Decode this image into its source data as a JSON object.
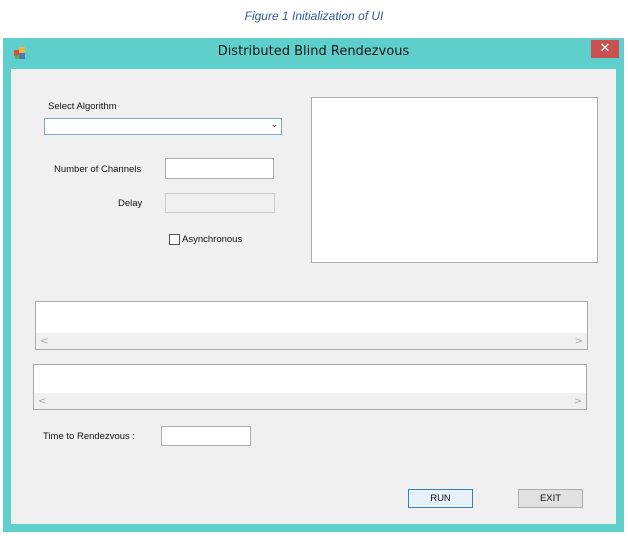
{
  "caption": "Figure 1 Initialization of UI",
  "window": {
    "title": "Distributed Blind Rendezvous",
    "close_glyph": "✕"
  },
  "form": {
    "select_algorithm_label": "Select Algorithm",
    "select_algorithm_value": "",
    "dropdown_arrow": "⌄",
    "channels_label": "Number of Channels",
    "channels_value": "",
    "delay_label": "Delay",
    "delay_value": "",
    "async_label": "Asynchronous",
    "async_checked": false,
    "time_label": "Time to Rendezvous :",
    "time_value": ""
  },
  "scroll_arrows": {
    "left": "<",
    "right": ">"
  },
  "buttons": {
    "run": "RUN",
    "exit": "EXIT"
  },
  "colors": {
    "titlebar": "#5ecfca",
    "close": "#c75050",
    "client": "#f0f0f0"
  }
}
